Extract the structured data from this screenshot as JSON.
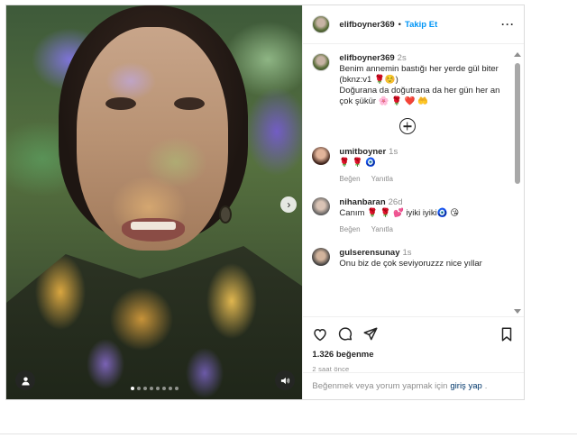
{
  "post": {
    "username": "elifboyner369",
    "follow_label": "Takip Et",
    "separator": "•"
  },
  "caption": {
    "username": "elifboyner369",
    "time": "2s",
    "line1": "Benim annemin bastığı her yerde gül biter",
    "line2": "(bknz:v1 🌹☺️)",
    "line3": "Doğurana da doğutrana da her gün her an çok şükür 🌸 🌹 ❤️ 🤲"
  },
  "comments": [
    {
      "username": "umitboyner",
      "time": "1s",
      "text": "🌹 🌹 🧿",
      "like_label": "Beğen",
      "reply_label": "Yanıtla"
    },
    {
      "username": "nihanbaran",
      "time": "26d",
      "text": "Canım 🌹 🌹 💕 iyiki iyiki🧿 😘",
      "like_label": "Beğen",
      "reply_label": "Yanıtla"
    },
    {
      "username": "gulserensunay",
      "time": "1s",
      "text": "Onu biz de çok seviyoruzzz nice yıllar"
    }
  ],
  "engagement": {
    "likes": "1.326 beğenme",
    "posted": "2 saat önce"
  },
  "login_prompt": {
    "prefix": "Beğenmek veya yorum yapmak için",
    "link": "giriş yap",
    "suffix": "."
  },
  "carousel": {
    "slide_count": 8,
    "active_index": 0
  },
  "colors": {
    "accent": "#0095f6",
    "link": "#00376b",
    "muted": "#8e8e8e"
  }
}
